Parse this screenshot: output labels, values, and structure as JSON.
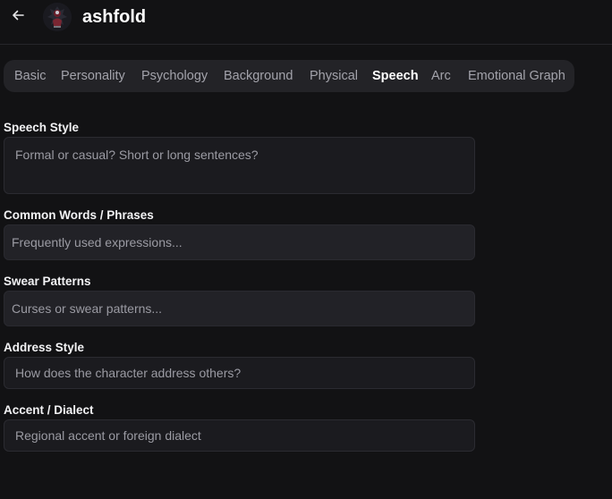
{
  "header": {
    "title": "ashfold",
    "back_icon": "arrow-left-icon",
    "avatar_icon": "character-avatar"
  },
  "tabs": [
    {
      "label": "Basic",
      "active": false
    },
    {
      "label": "Personality",
      "active": false
    },
    {
      "label": "Psychology",
      "active": false
    },
    {
      "label": "Background",
      "active": false
    },
    {
      "label": "Physical",
      "active": false
    },
    {
      "label": "Speech",
      "active": true
    },
    {
      "label": "Arc",
      "active": false
    },
    {
      "label": "Emotional Graph",
      "active": false
    }
  ],
  "form": {
    "speech_style": {
      "label": "Speech Style",
      "placeholder": "Formal or casual? Short or long sentences?",
      "value": ""
    },
    "common_words": {
      "label": "Common Words / Phrases",
      "placeholder": "Frequently used expressions...",
      "value": ""
    },
    "swear_patterns": {
      "label": "Swear Patterns",
      "placeholder": "Curses or swear patterns...",
      "value": ""
    },
    "address_style": {
      "label": "Address Style",
      "placeholder": "How does the character address others?",
      "value": ""
    },
    "accent_dialect": {
      "label": "Accent / Dialect",
      "placeholder": "Regional accent or foreign dialect",
      "value": ""
    }
  },
  "colors": {
    "background": "#121214",
    "tabbar": "#232327",
    "field": "#1b1b1f",
    "field_filled": "#222227",
    "active_tab": "#ffffff",
    "inactive_tab": "#a3a3ab"
  }
}
